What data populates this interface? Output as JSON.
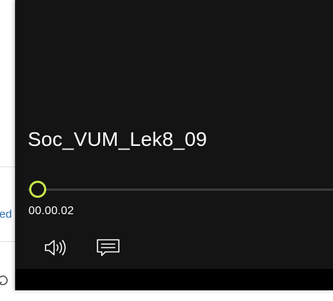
{
  "background_app": {
    "link_fragment": "ed"
  },
  "player": {
    "title": "Soc_VUM_Lek8_09",
    "elapsed_time": "00.00.02",
    "progress": 0.0,
    "accent_color": "#c7e84a",
    "icons": {
      "volume": "speaker-volume-icon",
      "captions": "closed-captions-icon",
      "search": "search-icon"
    }
  }
}
